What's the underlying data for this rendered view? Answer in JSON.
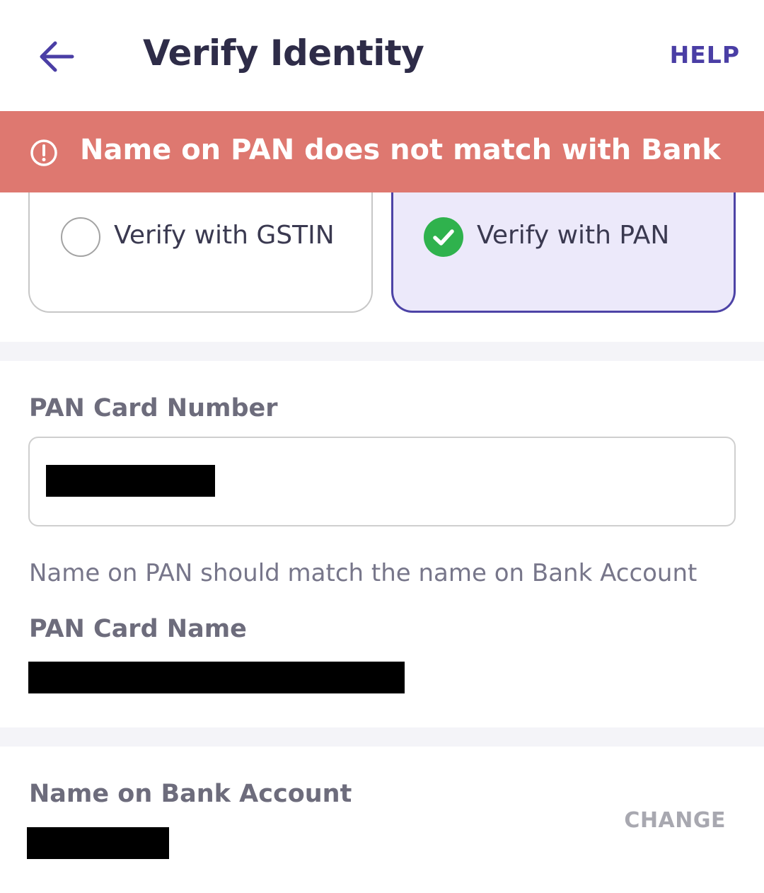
{
  "header": {
    "title": "Verify Identity",
    "help_label": "HELP",
    "back_icon": "arrow-left-icon",
    "accent_color": "#4a3ea5"
  },
  "banner": {
    "message": "Name on PAN does not match with Bank",
    "icon": "alert-circle-icon",
    "color": "#de7870"
  },
  "options": {
    "gstin_label": "Verify with GSTIN",
    "pan_label": "Verify with PAN",
    "selected": "pan",
    "check_color": "#2fb24d"
  },
  "pan": {
    "number_label": "PAN Card Number",
    "hint": "Name on PAN should match the name on Bank Account",
    "name_label": "PAN Card Name"
  },
  "bank": {
    "name_label": "Name on Bank Account",
    "change_label": "CHANGE"
  }
}
